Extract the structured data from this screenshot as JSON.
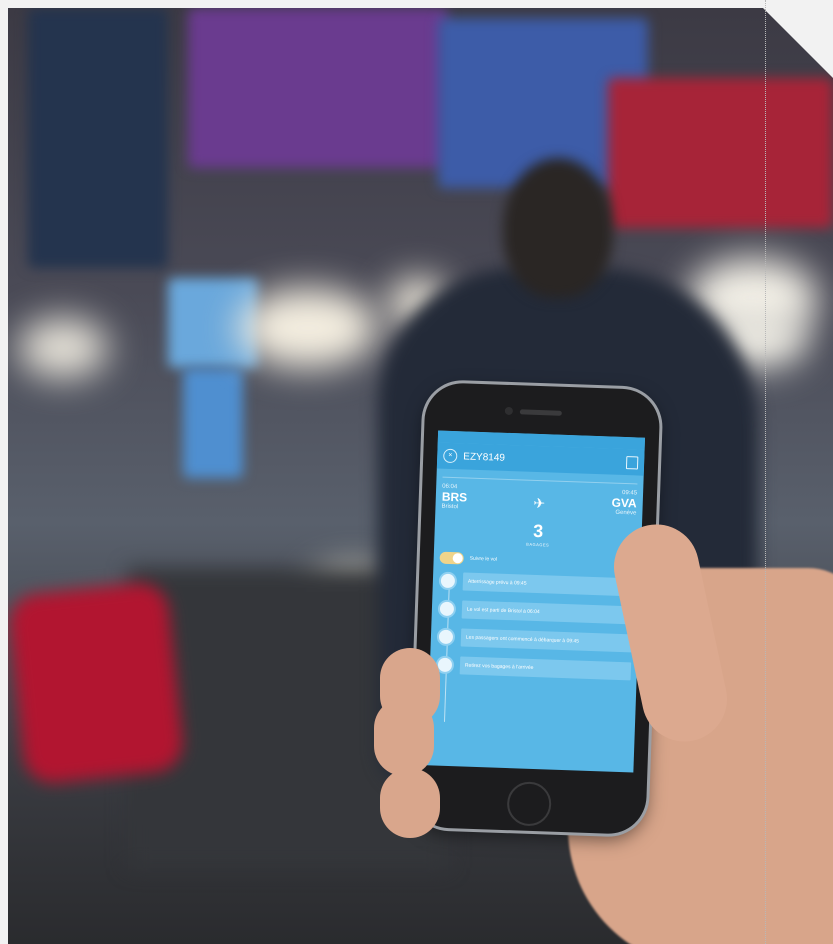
{
  "phone_app": {
    "status_bar": {
      "carrier": "",
      "time": "",
      "battery": ""
    },
    "nav": {
      "flight_code": "EZY8149"
    },
    "route": {
      "departure": {
        "time": "06:04",
        "code": "BRS",
        "city": "Bristol"
      },
      "arrival": {
        "time": "09:45",
        "code": "GVA",
        "city": "Genève"
      }
    },
    "passengers": {
      "count": "3",
      "label": "BAGAGES"
    },
    "follow": {
      "title": "Suivre le vol",
      "subtitle": ""
    },
    "events": [
      {
        "text": "Atterrissage prévu à 09:45"
      },
      {
        "text": "Le vol est parti de Bristol à 06:04"
      },
      {
        "text": "Les passagers ont commencé à débarquer à 09:45"
      },
      {
        "text": "Retirez vos bagages à l'arrivée"
      }
    ]
  },
  "icons": {
    "close": "close-icon",
    "share": "share-icon",
    "plane": "plane-icon",
    "info": "info-icon"
  },
  "colors": {
    "screen_blue": "#58b7e6",
    "header_blue": "#3aa4dc",
    "toggle_yellow": "#f0d48a"
  }
}
